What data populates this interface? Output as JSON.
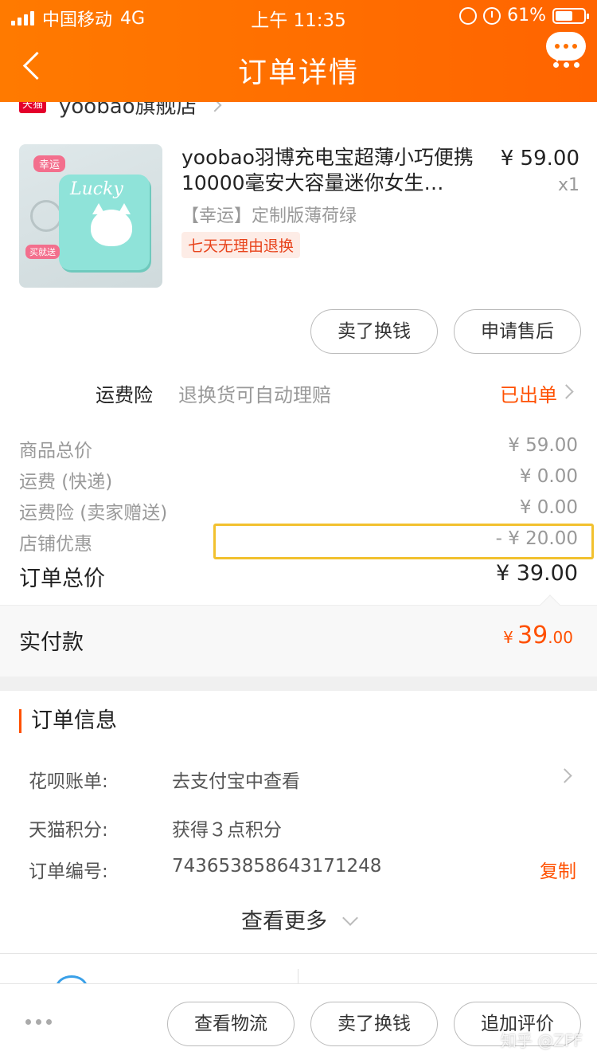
{
  "status_bar": {
    "carrier": "中国移动",
    "network": "4G",
    "time": "上午 11:35",
    "battery": "61%",
    "battery_fraction": 0.61
  },
  "nav": {
    "title": "订单详情",
    "back_icon": "chevron-left-icon",
    "message_icon": "message-bubble-icon"
  },
  "store": {
    "badge": "天猫",
    "name": "yoobao旗舰店"
  },
  "product": {
    "title": "yoobao羽博充电宝超薄小巧便携10000毫安大容量迷你女生…",
    "price": "¥ 59.00",
    "quantity": "x1",
    "sku": "【幸运】定制版薄荷绿",
    "badge": "七天无理由退换",
    "image": {
      "tag_top": "幸运",
      "brand_text": "Lucky",
      "tag_bottom": "买就送"
    }
  },
  "product_actions": {
    "sell_label": "卖了换钱",
    "aftersale_label": "申请售后"
  },
  "insurance": {
    "label": "运费险",
    "description": "退换货可自动理赔",
    "status": "已出单"
  },
  "fees": [
    {
      "label": "商品总价",
      "value": "¥ 59.00"
    },
    {
      "label": "运费 (快递)",
      "value": "¥ 0.00"
    },
    {
      "label": "运费险 (卖家赠送)",
      "value": "¥ 0.00"
    },
    {
      "label": "店铺优惠",
      "value": "- ¥ 20.00"
    }
  ],
  "total": {
    "label": "订单总价",
    "value": "¥ 39.00"
  },
  "paid": {
    "label": "实付款",
    "currency": "¥",
    "integer": "39",
    "decimal": ".00"
  },
  "order_info": {
    "title": "订单信息",
    "rows": [
      {
        "label": "花呗账单:",
        "value": "去支付宝中查看"
      },
      {
        "label": "天猫积分:",
        "value": "获得３点积分"
      },
      {
        "label": "订单编号:",
        "value": "743653858643171248"
      }
    ],
    "copy_label": "复制",
    "more_label": "查看更多"
  },
  "bottom_bar": {
    "logistics_label": "查看物流",
    "sell_label": "卖了换钱",
    "review_label": "追加评价"
  },
  "watermark": "知乎 @ZFF",
  "colors": {
    "accent": "#ff5000",
    "header_start": "#ff7a00",
    "header_end": "#ff6400",
    "highlight": "#f2c12e"
  }
}
